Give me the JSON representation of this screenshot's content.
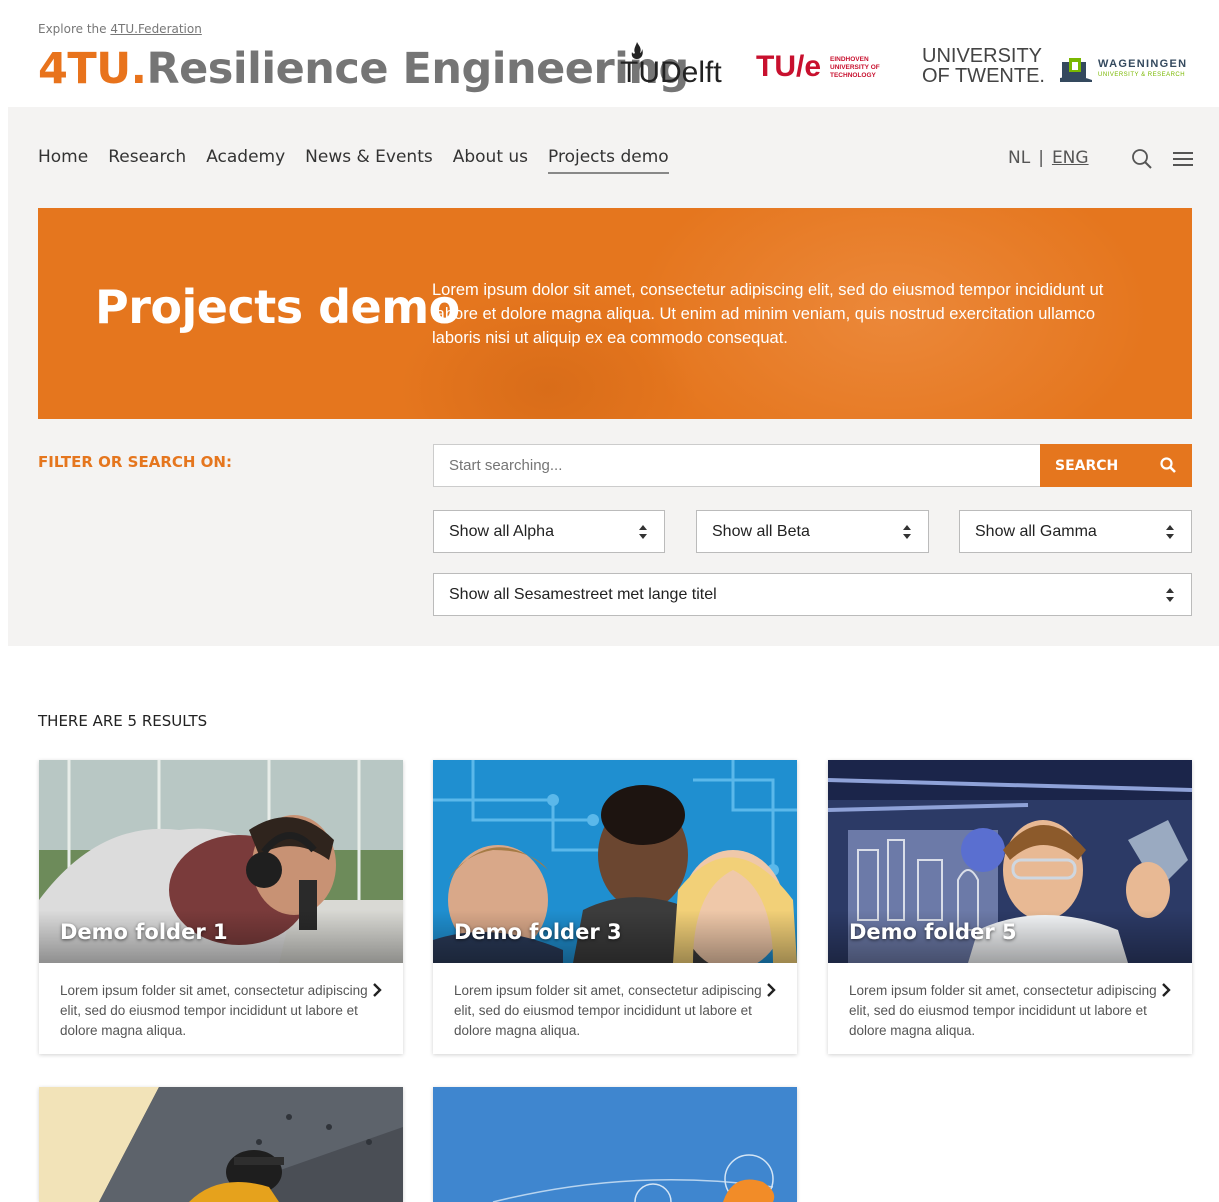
{
  "header": {
    "explore_prefix": "Explore the",
    "explore_link": "4TU.Federation",
    "brand_prefix": "4TU.",
    "brand_name": "Resilience Engineering"
  },
  "partners": {
    "tudelft": "UDelft",
    "tudelft_t": "T",
    "tue": "TU/e",
    "tue_small": "EINDHOVEN\nUNIVERSITY OF\nTECHNOLOGY",
    "twente_line1": "UNIVERSITY",
    "twente_line2": "OF TWENTE.",
    "wur_name": "WAGENINGEN",
    "wur_sub": "UNIVERSITY & RESEARCH"
  },
  "nav": {
    "items": [
      "Home",
      "Research",
      "Academy",
      "News & Events",
      "About us",
      "Projects demo"
    ],
    "active_index": 5,
    "lang_nl": "NL",
    "lang_sep": "|",
    "lang_eng": "ENG"
  },
  "hero": {
    "title": "Projects demo",
    "text": "Lorem ipsum dolor sit amet, consectetur adipiscing elit, sed do eiusmod tempor incididunt ut labore et dolore magna aliqua. Ut enim ad minim veniam, quis nostrud exercitation ullamco laboris nisi ut aliquip ex ea commodo consequat."
  },
  "filter": {
    "label": "FILTER OR SEARCH ON:",
    "search_placeholder": "Start searching...",
    "search_button": "SEARCH",
    "select_alpha": "Show all Alpha",
    "select_beta": "Show all Beta",
    "select_gamma": "Show all Gamma",
    "select_sesame": "Show all Sesamestreet met lange titel"
  },
  "results": {
    "count_text": "THERE ARE 5 RESULTS",
    "cards": [
      {
        "title": "Demo folder 1",
        "desc": "Lorem ipsum folder sit amet, consectetur adipiscing elit, sed do eiusmod tempor incididunt ut labore et dolore magna aliqua."
      },
      {
        "title": "Demo folder 3",
        "desc": "Lorem ipsum folder sit amet, consectetur adipiscing elit, sed do eiusmod tempor incididunt ut labore et dolore magna aliqua."
      },
      {
        "title": "Demo folder 5",
        "desc": "Lorem ipsum folder sit amet, consectetur adipiscing elit, sed do eiusmod tempor incididunt ut labore et dolore magna aliqua."
      }
    ]
  },
  "colors": {
    "accent": "#e5761e",
    "brand_gray": "#757575",
    "panel_bg": "#f4f3f2"
  }
}
